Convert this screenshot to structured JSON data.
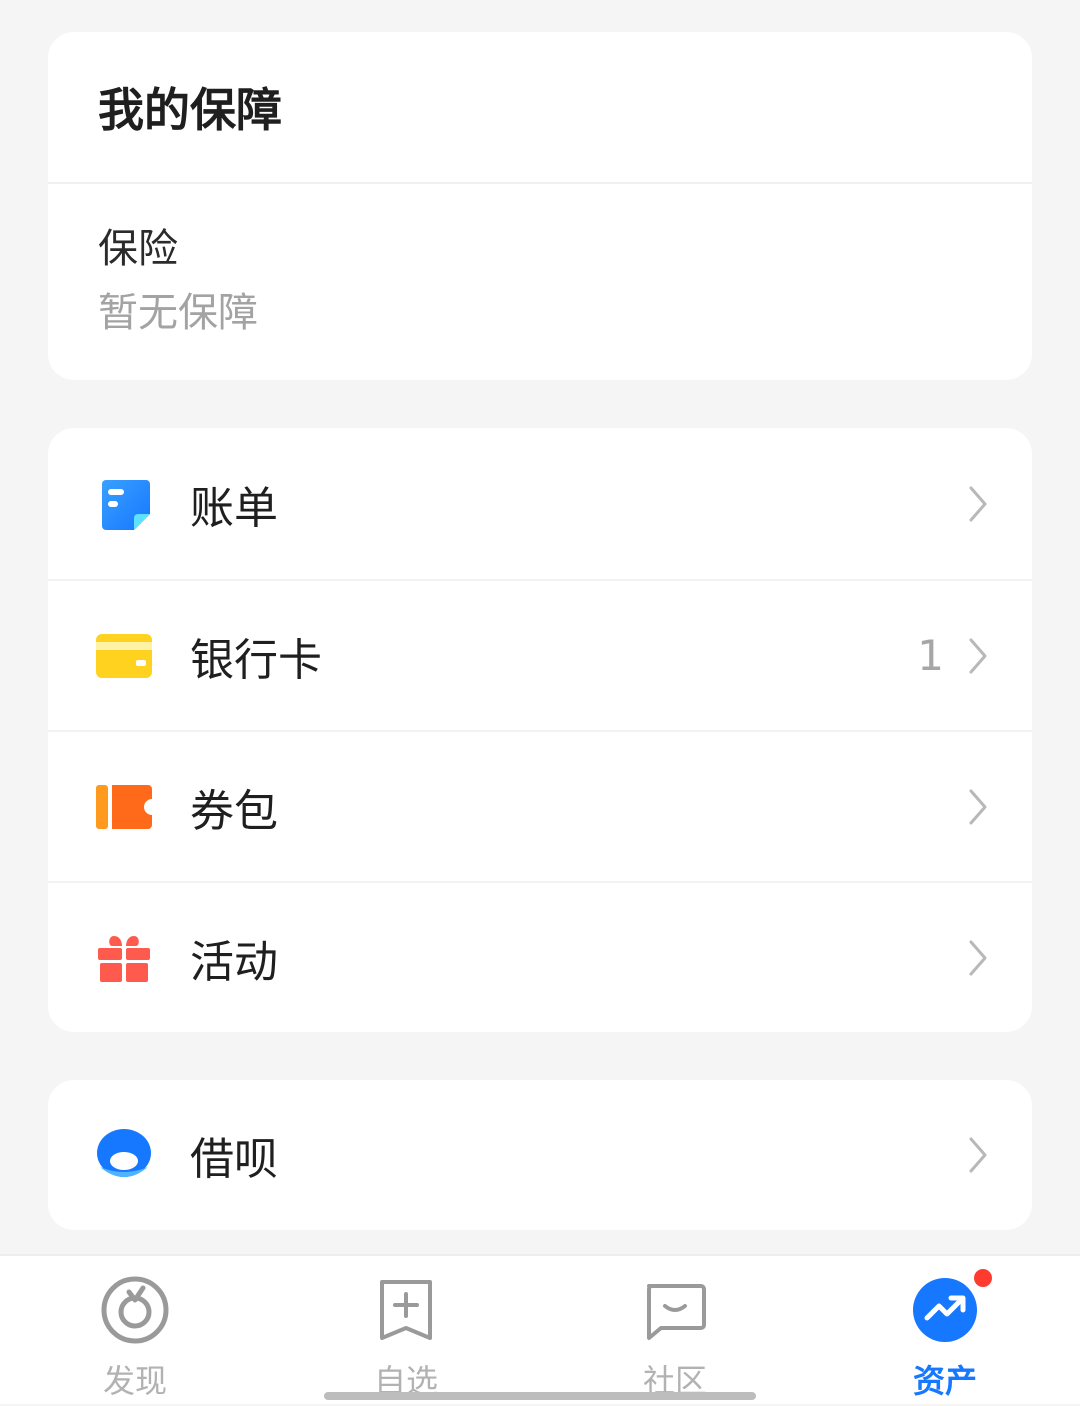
{
  "protection": {
    "title": "我的保障",
    "insurance_label": "保险",
    "insurance_value": "暂无保障"
  },
  "menu": {
    "items": [
      {
        "label": "账单",
        "icon": "bill-icon",
        "count": ""
      },
      {
        "label": "银行卡",
        "icon": "bank-card-icon",
        "count": "1"
      },
      {
        "label": "券包",
        "icon": "coupon-icon",
        "count": ""
      },
      {
        "label": "活动",
        "icon": "gift-icon",
        "count": ""
      }
    ]
  },
  "jiebei": {
    "label": "借呗",
    "icon": "jiebei-icon"
  },
  "tabbar": {
    "tabs": [
      {
        "label": "发现",
        "icon": "discover-icon"
      },
      {
        "label": "自选",
        "icon": "watchlist-icon"
      },
      {
        "label": "社区",
        "icon": "community-icon"
      },
      {
        "label": "资产",
        "icon": "assets-icon",
        "active": true
      }
    ]
  },
  "colors": {
    "accent": "#1677ff",
    "background": "#f5f5f5",
    "muted_text": "#a3a3a3",
    "badge": "#ff3b30"
  }
}
